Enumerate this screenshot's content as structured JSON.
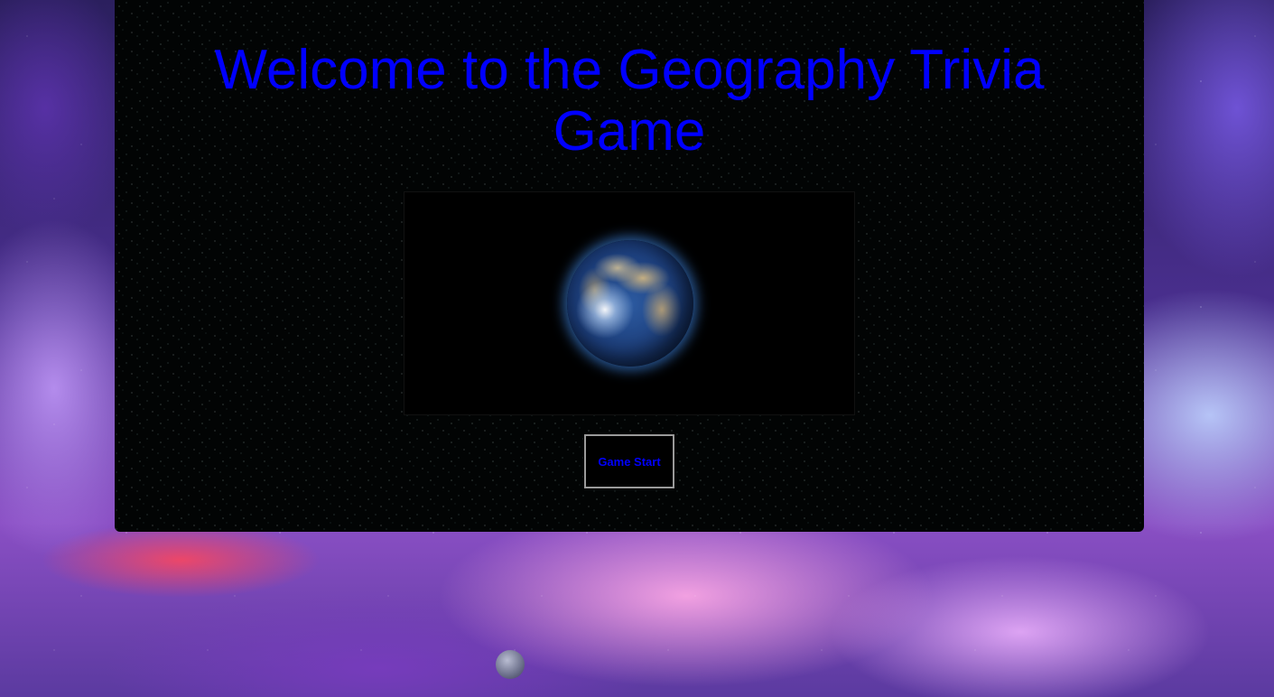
{
  "page": {
    "title": "Welcome to the Geography Trivia Game"
  },
  "hero_image": {
    "icon": "earth-globe-icon"
  },
  "start": {
    "label": "Game Start"
  },
  "colors": {
    "title_text": "#0000ff",
    "button_text": "#0000ff",
    "panel_background": "#020404",
    "button_border": "#9a9a9a"
  }
}
